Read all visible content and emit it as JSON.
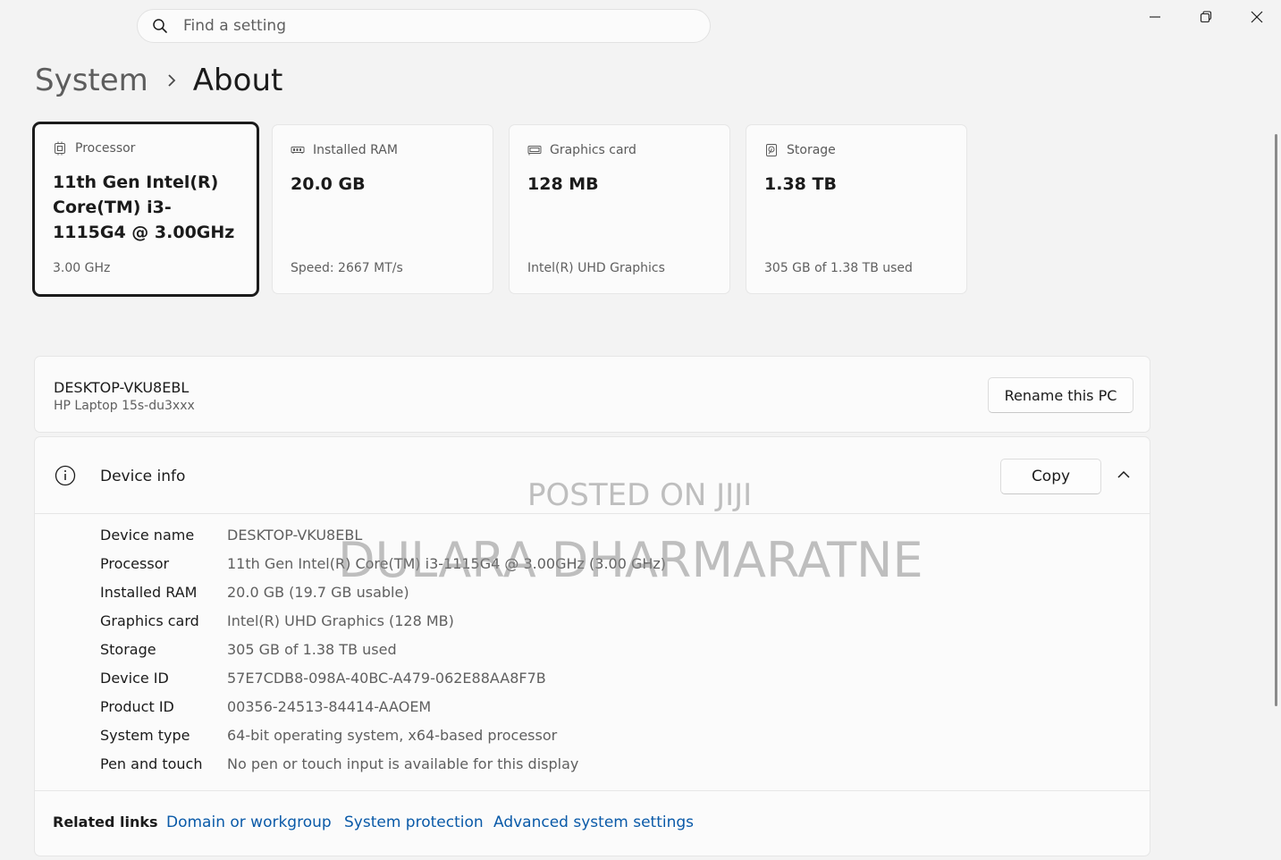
{
  "search": {
    "placeholder": "Find a setting"
  },
  "breadcrumb": {
    "parent": "System",
    "current": "About"
  },
  "cards": [
    {
      "label": "Processor",
      "value": "11th Gen Intel(R) Core(TM) i3-1115G4 @ 3.00GHz",
      "sub": "3.00 GHz",
      "icon": "processor-icon"
    },
    {
      "label": "Installed RAM",
      "value": "20.0 GB",
      "sub": "Speed: 2667 MT/s",
      "icon": "ram-icon"
    },
    {
      "label": "Graphics card",
      "value": "128 MB",
      "sub": "Intel(R) UHD Graphics",
      "icon": "graphics-card-icon"
    },
    {
      "label": "Storage",
      "value": "1.38 TB",
      "sub": "305 GB of 1.38 TB used",
      "icon": "storage-icon"
    }
  ],
  "pc": {
    "name": "DESKTOP-VKU8EBL",
    "model": "HP Laptop 15s-du3xxx",
    "rename_label": "Rename this PC"
  },
  "device_info": {
    "title": "Device info",
    "copy_label": "Copy",
    "rows": [
      {
        "key": "Device name",
        "value": "DESKTOP-VKU8EBL"
      },
      {
        "key": "Processor",
        "value": "11th Gen Intel(R) Core(TM) i3-1115G4 @ 3.00GHz (3.00 GHz)"
      },
      {
        "key": "Installed RAM",
        "value": "20.0 GB (19.7 GB usable)"
      },
      {
        "key": "Graphics card",
        "value": "Intel(R) UHD Graphics (128 MB)"
      },
      {
        "key": "Storage",
        "value": "305 GB of 1.38 TB used"
      },
      {
        "key": "Device ID",
        "value": "57E7CDB8-098A-40BC-A479-062E88AA8F7B"
      },
      {
        "key": "Product ID",
        "value": "00356-24513-84414-AAOEM"
      },
      {
        "key": "System type",
        "value": "64-bit operating system, x64-based processor"
      },
      {
        "key": "Pen and touch",
        "value": "No pen or touch input is available for this display"
      }
    ]
  },
  "related": {
    "label": "Related links",
    "links": [
      "Domain or workgroup",
      "System protection",
      "Advanced system settings"
    ]
  },
  "watermark": {
    "line1": "POSTED ON JIJI",
    "line2": "DULARA DHARMARATNE"
  },
  "colors": {
    "background": "#f3f3f3",
    "card": "#fbfbfb",
    "link": "#0a5aa8",
    "selected_border": "#1b1b1b"
  }
}
